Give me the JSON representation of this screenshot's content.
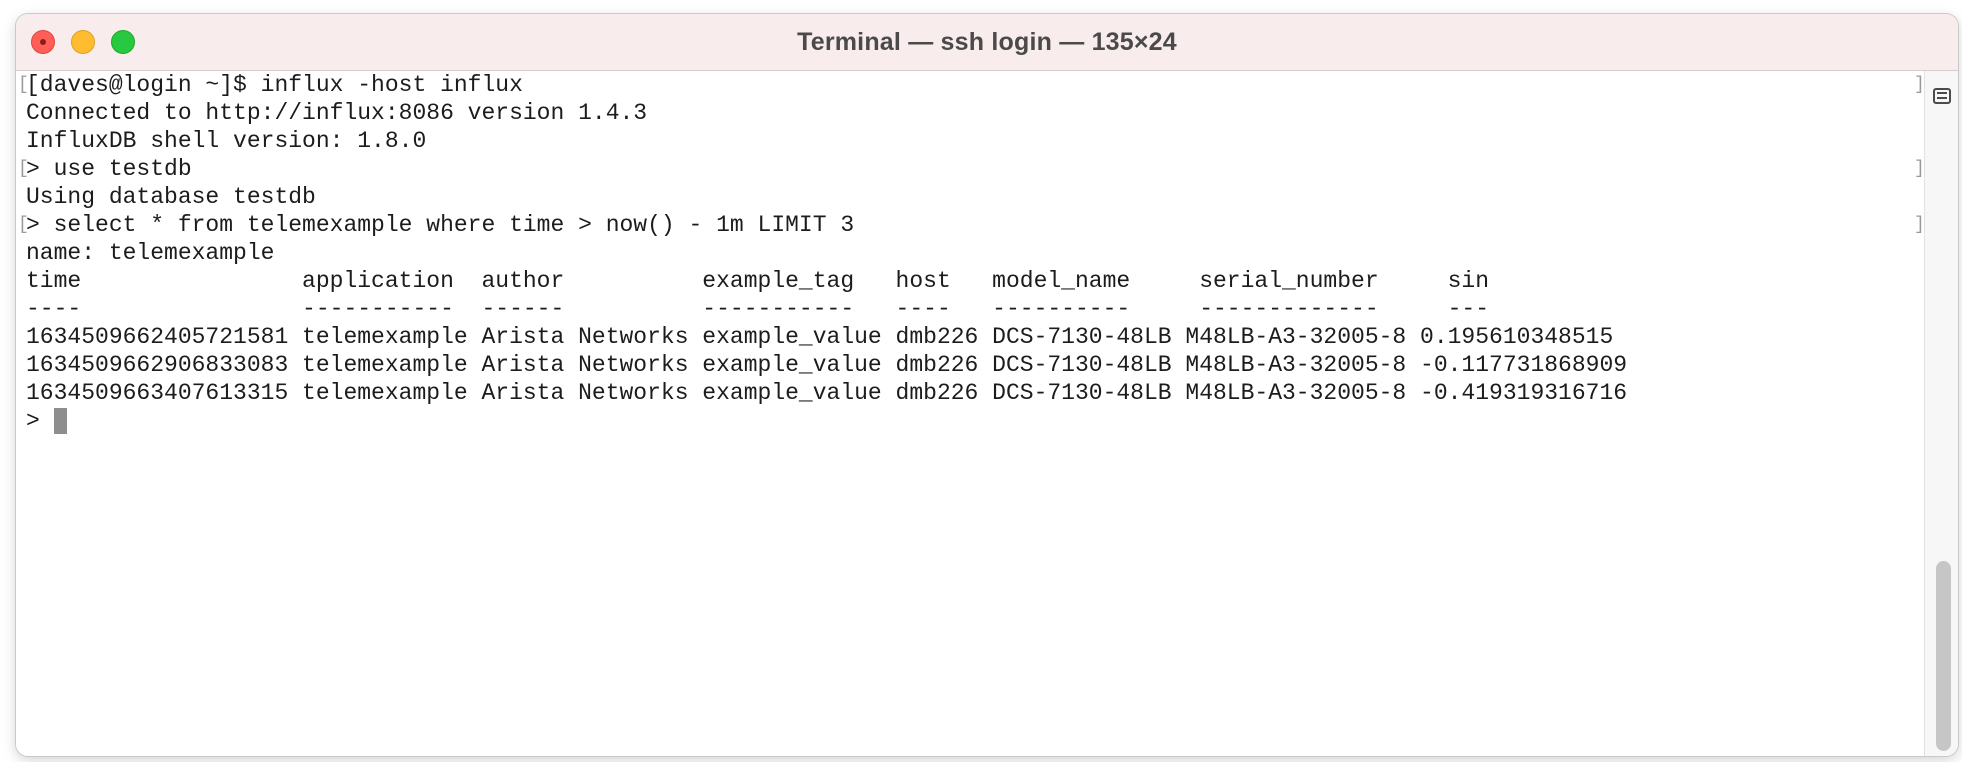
{
  "window": {
    "title": "Terminal — ssh login — 135×24"
  },
  "terminal": {
    "lines": [
      "[daves@login ~]$ influx -host influx",
      "Connected to http://influx:8086 version 1.4.3",
      "InfluxDB shell version: 1.8.0",
      "> use testdb",
      "Using database testdb",
      "> select * from telemexample where time > now() - 1m LIMIT 3",
      "name: telemexample",
      "time                application  author          example_tag   host   model_name     serial_number     sin",
      "----                -----------  ------          -----------   ----   ----------     -------------     ---",
      "1634509662405721581 telemexample Arista Networks example_value dmb226 DCS-7130-48LB M48LB-A3-32005-8 0.195610348515",
      "1634509662906833083 telemexample Arista Networks example_value dmb226 DCS-7130-48LB M48LB-A3-32005-8 -0.117731868909",
      "1634509663407613315 telemexample Arista Networks example_value dmb226 DCS-7130-48LB M48LB-A3-32005-8 -0.419319316716"
    ],
    "prompt": "> ",
    "bracket_left": "[",
    "bracket_right": "]"
  },
  "colors": {
    "titlebar": "#f9ecec",
    "text": "#1c1c1c",
    "close": "#ff5f57",
    "minimize": "#febc2e",
    "zoom": "#28c840"
  },
  "icons": {
    "close": "close-icon",
    "minimize": "minimize-icon",
    "zoom": "zoom-icon",
    "marks": "marks-icon"
  }
}
